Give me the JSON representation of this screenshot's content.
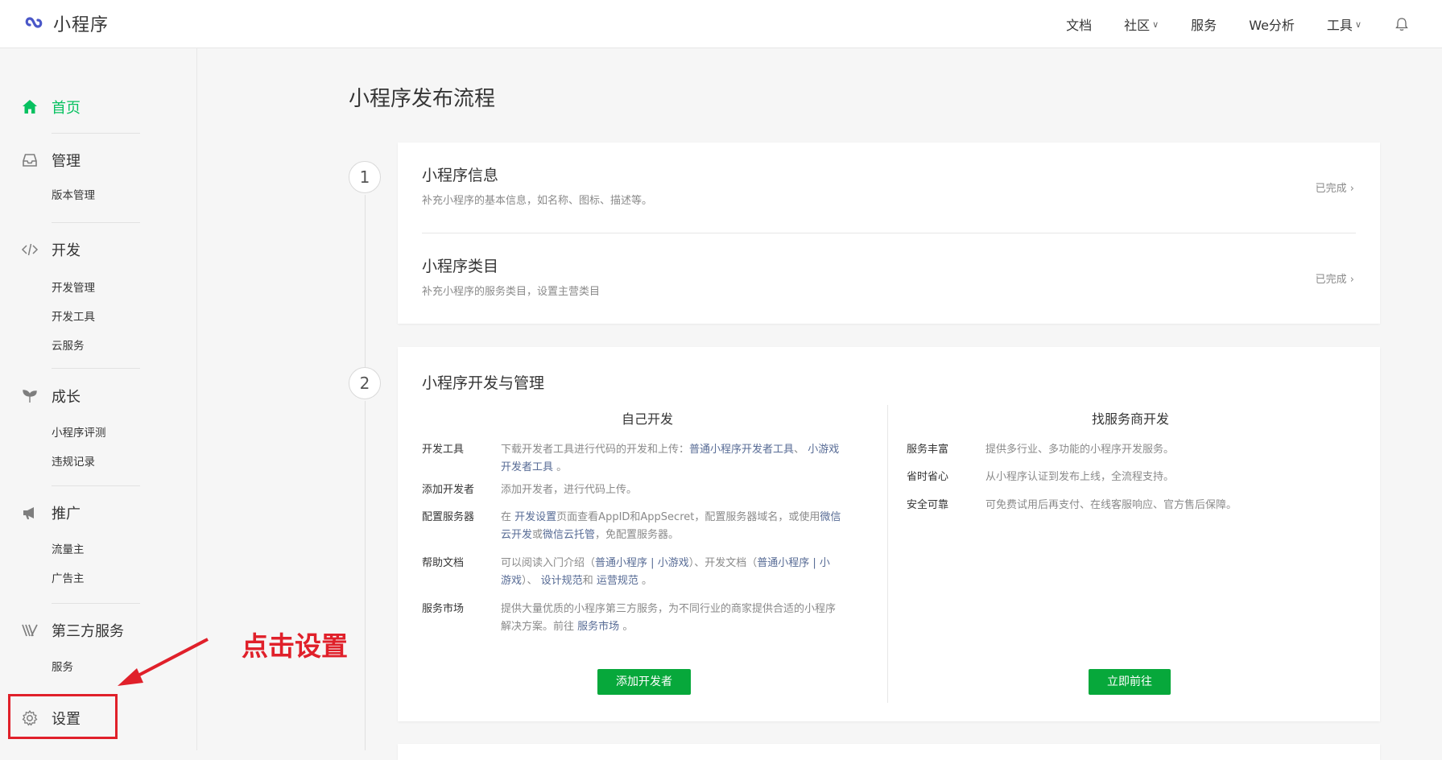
{
  "app": {
    "logo_text": "小程序"
  },
  "topnav": {
    "items": [
      {
        "label": "文档",
        "has_dropdown": false
      },
      {
        "label": "社区",
        "has_dropdown": true
      },
      {
        "label": "服务",
        "has_dropdown": false
      },
      {
        "label": "We分析",
        "has_dropdown": false
      },
      {
        "label": "工具",
        "has_dropdown": true
      }
    ],
    "chevron": "∨",
    "bell_icon": "bell-icon"
  },
  "sidebar": {
    "home": {
      "label": "首页",
      "icon": "home-icon"
    },
    "manage": {
      "label": "管理",
      "icon": "inbox-icon",
      "subs": [
        "版本管理"
      ]
    },
    "develop": {
      "label": "开发",
      "icon": "code-icon",
      "subs": [
        "开发管理",
        "开发工具",
        "云服务"
      ]
    },
    "growth": {
      "label": "成长",
      "icon": "sprout-icon",
      "subs": [
        "小程序评测",
        "违规记录"
      ]
    },
    "promote": {
      "label": "推广",
      "icon": "megaphone-icon",
      "subs": [
        "流量主",
        "广告主"
      ]
    },
    "third": {
      "label": "第三方服务",
      "icon": "third-party-icon",
      "subs": [
        "服务"
      ]
    },
    "settings": {
      "label": "设置",
      "icon": "gear-icon"
    }
  },
  "main": {
    "title": "小程序发布流程",
    "step1": {
      "number": "1",
      "items": [
        {
          "title": "小程序信息",
          "desc": "补充小程序的基本信息，如名称、图标、描述等。",
          "status": "已完成"
        },
        {
          "title": "小程序类目",
          "desc": "补充小程序的服务类目，设置主营类目",
          "status": "已完成"
        }
      ],
      "status_chevron": "›"
    },
    "step2": {
      "number": "2",
      "title": "小程序开发与管理",
      "left": {
        "heading": "自己开发",
        "rows": [
          {
            "key": "开发工具",
            "line1_pre": "下载开发者工具进行代码的开发和上传：",
            "link1": "普通小程序开发者工具",
            "sep": "、",
            "link2a": "小游戏",
            "link2b": "开发者工具",
            "tail": "。"
          },
          {
            "key": "添加开发者",
            "text": "添加开发者，进行代码上传。"
          },
          {
            "key": "配置服务器",
            "pre": "在",
            "link1": "开发设置",
            "mid": "页面查看AppID和AppSecret，配置服务器域名，或使用",
            "link2a": "微信",
            "link2b": "云开发",
            "mid2": "或",
            "link3": "微信云托管",
            "tail": "，免配置服务器。"
          },
          {
            "key": "帮助文档",
            "pre": "可以阅读入门介绍（",
            "link1": "普通小程序",
            "bar": " | ",
            "link2": "小游戏",
            "mid": "）、开发文档（",
            "link3": "普通小程序",
            "bar2": " | ",
            "link4a": "小",
            "link4b": "游戏",
            "mid2": "）、",
            "link5": "设计规范",
            "and": "和",
            "link6": "运营规范",
            "tail": "。"
          },
          {
            "key": "服务市场",
            "line1": "提供大量优质的小程序第三方服务，为不同行业的商家提供合适的小程序",
            "pre2": "解决方案。前往",
            "link1": "服务市场",
            "tail": "。"
          }
        ],
        "button": "添加开发者"
      },
      "right": {
        "heading": "找服务商开发",
        "rows": [
          {
            "key": "服务丰富",
            "text": "提供多行业、多功能的小程序开发服务。"
          },
          {
            "key": "省时省心",
            "text": "从小程序认证到发布上线，全流程支持。"
          },
          {
            "key": "安全可靠",
            "text": "可免费试用后再支付、在线客服响应、官方售后保障。"
          }
        ],
        "button": "立即前往"
      }
    }
  },
  "annotation": {
    "text": "点击设置",
    "color": "#e0202a"
  },
  "colors": {
    "accent": "#07c160",
    "button": "#07a83b",
    "link": "#576b95"
  }
}
